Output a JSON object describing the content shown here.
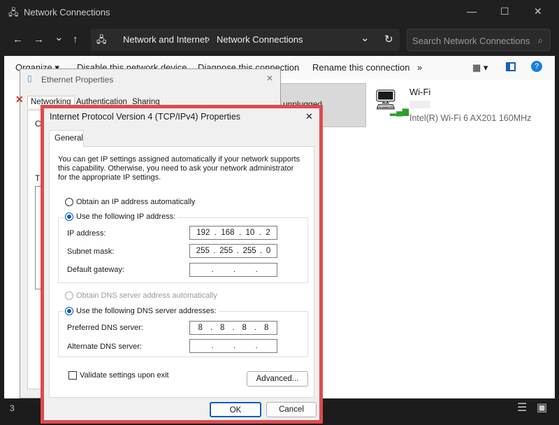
{
  "window": {
    "title": "Network Connections",
    "minimize": "—",
    "maximize": "☐",
    "close": "✕"
  },
  "address": {
    "back": "←",
    "forward": "→",
    "recent": "⌄",
    "up": "↑",
    "breadcrumb": [
      "Network and Internet",
      "Network Connections"
    ],
    "sep": "›",
    "dropdown": "⌄",
    "refresh": "↻"
  },
  "search": {
    "placeholder": "Search Network Connections"
  },
  "toolbar": {
    "organize": "Organize ▾",
    "disable": "Disable this network device",
    "diagnose": "Diagnose this connection",
    "rename": "Rename this connection",
    "more": "»"
  },
  "tiles": [
    {
      "status": "unplugged"
    },
    {
      "name": "Wi-Fi",
      "adapter": "Intel(R) Wi-Fi 6 AX201 160MHz"
    }
  ],
  "ethernet_dialog": {
    "title": "Ethernet Properties",
    "tabs": [
      "Networking",
      "Authentication",
      "Sharing"
    ],
    "partial_text_1": "Co",
    "partial_text_2": "Th"
  },
  "ipv4_dialog": {
    "title": "Internet Protocol Version 4 (TCP/IPv4) Properties",
    "tab": "General",
    "description": "You can get IP settings assigned automatically if your network supports this capability. Otherwise, you need to ask your network administrator for the appropriate IP settings.",
    "obtain_ip_auto": "Obtain an IP address automatically",
    "use_ip": "Use the following IP address:",
    "ip_label": "IP address:",
    "ip_value": [
      "192",
      "168",
      "10",
      "2"
    ],
    "mask_label": "Subnet mask:",
    "mask_value": [
      "255",
      "255",
      "255",
      "0"
    ],
    "gateway_label": "Default gateway:",
    "gateway_value": [
      "",
      "",
      "",
      ""
    ],
    "obtain_dns_auto": "Obtain DNS server address automatically",
    "use_dns": "Use the following DNS server addresses:",
    "pref_dns_label": "Preferred DNS server:",
    "pref_dns_value": [
      "8",
      "8",
      "8",
      "8"
    ],
    "alt_dns_label": "Alternate DNS server:",
    "alt_dns_value": [
      "",
      "",
      "",
      ""
    ],
    "validate": "Validate settings upon exit",
    "advanced": "Advanced...",
    "ok": "OK",
    "cancel": "Cancel"
  },
  "statusbar": {
    "count": "3"
  },
  "colors": {
    "highlight": "#e04a4f",
    "accent": "#005fb8"
  }
}
